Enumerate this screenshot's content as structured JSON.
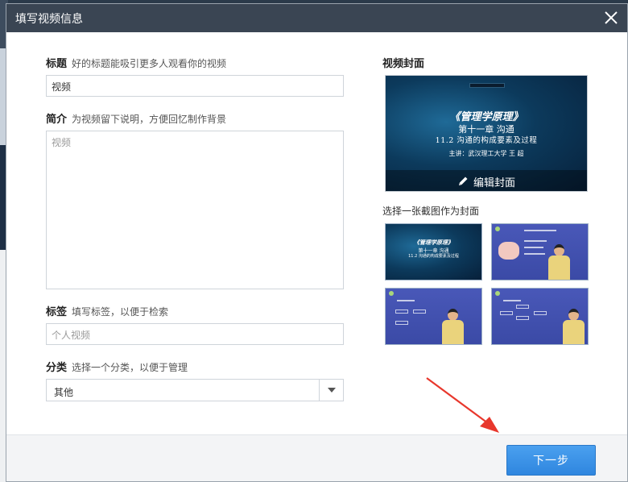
{
  "dialog": {
    "title": "填写视频信息",
    "close_icon": "close-icon"
  },
  "form": {
    "title_label": "标题",
    "title_hint": "好的标题能吸引更多人观看你的视频",
    "title_value": "视频",
    "intro_label": "简介",
    "intro_hint": "为视频留下说明，方便回忆制作背景",
    "intro_placeholder": "视频",
    "tags_label": "标签",
    "tags_hint": "填写标签，以便于检索",
    "tags_placeholder": "个人视频",
    "category_label": "分类",
    "category_hint": "选择一个分类，以便于管理",
    "category_value": "其他"
  },
  "cover": {
    "heading": "视频封面",
    "line1": "《管理学原理》",
    "line2": "第十一章  沟通",
    "line3": "11.2  沟通的构成要素及过程",
    "line4": "主讲：武汉理工大学  王 超",
    "edit_label": "编辑封面",
    "choose_label": "选择一张截图作为封面"
  },
  "thumbnails": [
    {
      "line1": "《管理学原理》",
      "line2": "第十一章  沟通",
      "line3": "11.2 沟通的构成要素及过程"
    },
    {
      "line1": "",
      "line2": "",
      "line3": ""
    },
    {
      "line1": "",
      "line2": "",
      "line3": ""
    },
    {
      "line1": "",
      "line2": "",
      "line3": ""
    }
  ],
  "footer": {
    "next_label": "下一步"
  },
  "colors": {
    "titlebar": "#3a4553",
    "primary_button": "#3a8ee6",
    "arrow": "#e8372c"
  }
}
